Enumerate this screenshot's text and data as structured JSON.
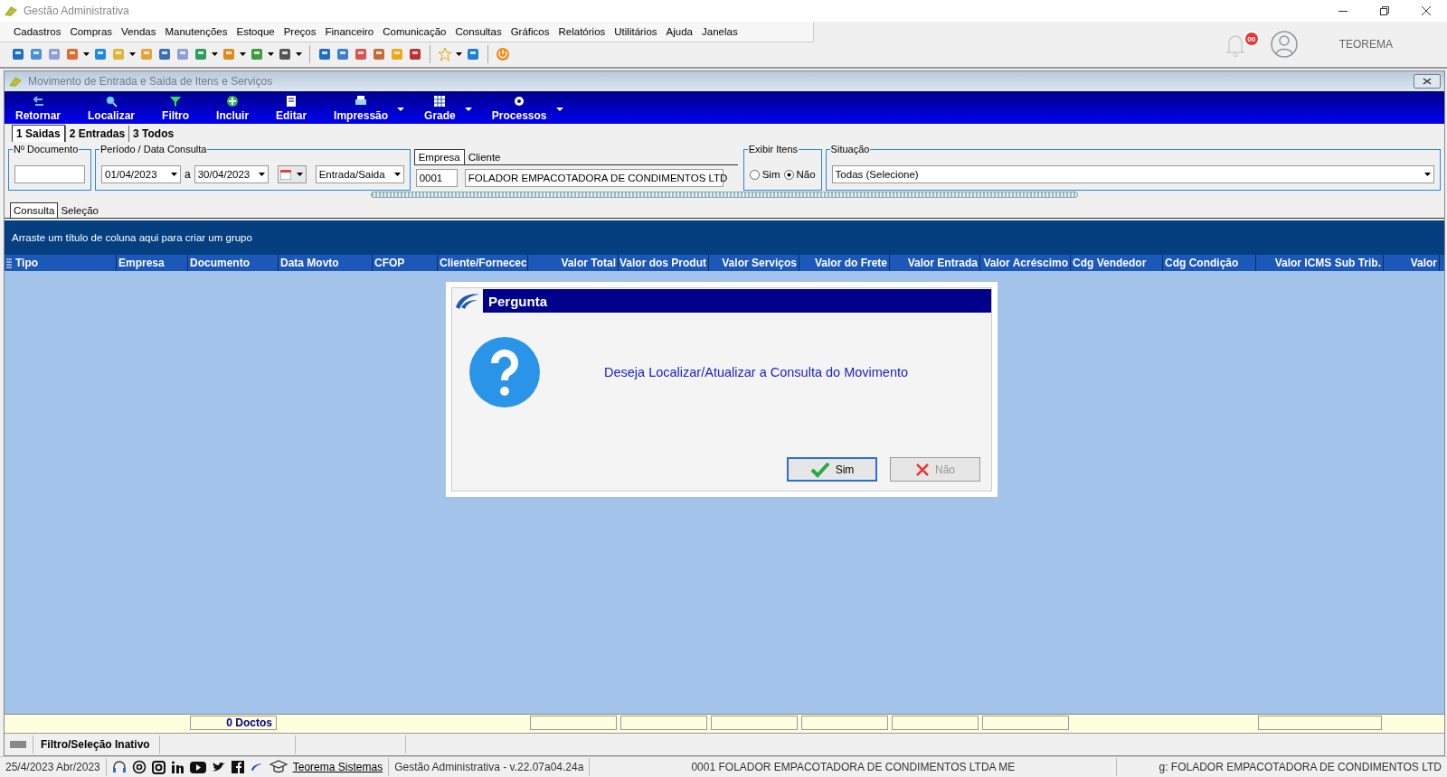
{
  "window": {
    "title": "Gestão Administrativa"
  },
  "menu": [
    "Cadastros",
    "Compras",
    "Vendas",
    "Manutenções",
    "Estoque",
    "Preços",
    "Financeiro",
    "Comunicação",
    "Consultas",
    "Gráficos",
    "Relatórios",
    "Utilitários",
    "Ajuda",
    "Janelas"
  ],
  "notifications": {
    "count": "00"
  },
  "user": {
    "name": "TEOREMA"
  },
  "child_window": {
    "title": "Movimento de Entrada e Saida de Itens e Serviços"
  },
  "actions": [
    {
      "label": "Retornar",
      "menu": false
    },
    {
      "label": "Localizar",
      "menu": false
    },
    {
      "label": "Filtro",
      "menu": false
    },
    {
      "label": "Incluir",
      "menu": false
    },
    {
      "label": "Editar",
      "menu": false
    },
    {
      "label": "Impressão",
      "menu": true
    },
    {
      "label": "Grade",
      "menu": true
    },
    {
      "label": "Processos",
      "menu": true
    }
  ],
  "tabs": [
    {
      "label": "1 Saidas",
      "selected": true
    },
    {
      "label": "2 Entradas",
      "selected": false
    },
    {
      "label": "3 Todos",
      "selected": false
    }
  ],
  "filters": {
    "documento": {
      "legend": "Nº Documento"
    },
    "periodo": {
      "legend": "Período / Data Consulta",
      "from": "01/04/2023",
      "separator": "a",
      "to": "30/04/2023",
      "type": "Entrada/Saida"
    },
    "party_tabs": [
      {
        "label": "Empresa",
        "selected": true
      },
      {
        "label": "Cliente",
        "selected": false
      }
    ],
    "empresa": "0001",
    "cliente": "FOLADOR EMPACOTADORA DE CONDIMENTOS LTD",
    "exibir_itens": {
      "legend": "Exibir Itens",
      "options": [
        {
          "label": "Sim",
          "selected": false
        },
        {
          "label": "Não",
          "selected": true
        }
      ]
    },
    "situacao": {
      "legend": "Situação",
      "value": "Todas (Selecione)"
    }
  },
  "view_tabs": [
    {
      "label": "Consulta",
      "selected": true
    },
    {
      "label": "Seleção",
      "selected": false
    }
  ],
  "grid": {
    "group_hint": "Arraste um título de coluna aqui para criar um grupo",
    "columns": [
      {
        "label": "Tipo",
        "summary": false
      },
      {
        "label": "Empresa",
        "summary": false
      },
      {
        "label": "Documento",
        "footer": "0 Doctos"
      },
      {
        "label": "Data Movto",
        "summary": false
      },
      {
        "label": "CFOP",
        "summary": false
      },
      {
        "label": "Cliente/Fornecec",
        "summary": false
      },
      {
        "label": "Valor Total",
        "summary": true
      },
      {
        "label": "Valor dos Produt",
        "summary": true
      },
      {
        "label": "Valor Serviços",
        "summary": true
      },
      {
        "label": "Valor do Frete",
        "summary": true
      },
      {
        "label": "Valor Entrada",
        "summary": true
      },
      {
        "label": "Valor Acréscimo",
        "summary": true
      },
      {
        "label": "Cdg Vendedor",
        "summary": false
      },
      {
        "label": "Cdg Condição",
        "summary": false
      },
      {
        "label": "Valor ICMS Sub Trib.",
        "summary": true
      },
      {
        "label": "Valor",
        "summary": false
      }
    ]
  },
  "filter_status": "Filtro/Seleção Inativo",
  "dialog": {
    "title": "Pergunta",
    "message": "Deseja Localizar/Atualizar a Consulta do Movimento",
    "buttons": [
      {
        "label": "Sim",
        "kind": "yes"
      },
      {
        "label": "Não",
        "kind": "no"
      }
    ]
  },
  "status_bar": {
    "date": "25/4/2023 Abr/2023",
    "link": "Teorema Sistemas",
    "version": "Gestão Administrativa - v.22.07a04.24a",
    "company": "0001 FOLADOR EMPACOTADORA DE CONDIMENTOS LTDA ME",
    "company_short": "g: FOLADOR EMPACOTADORA DE CONDIMENTOS LTD"
  }
}
